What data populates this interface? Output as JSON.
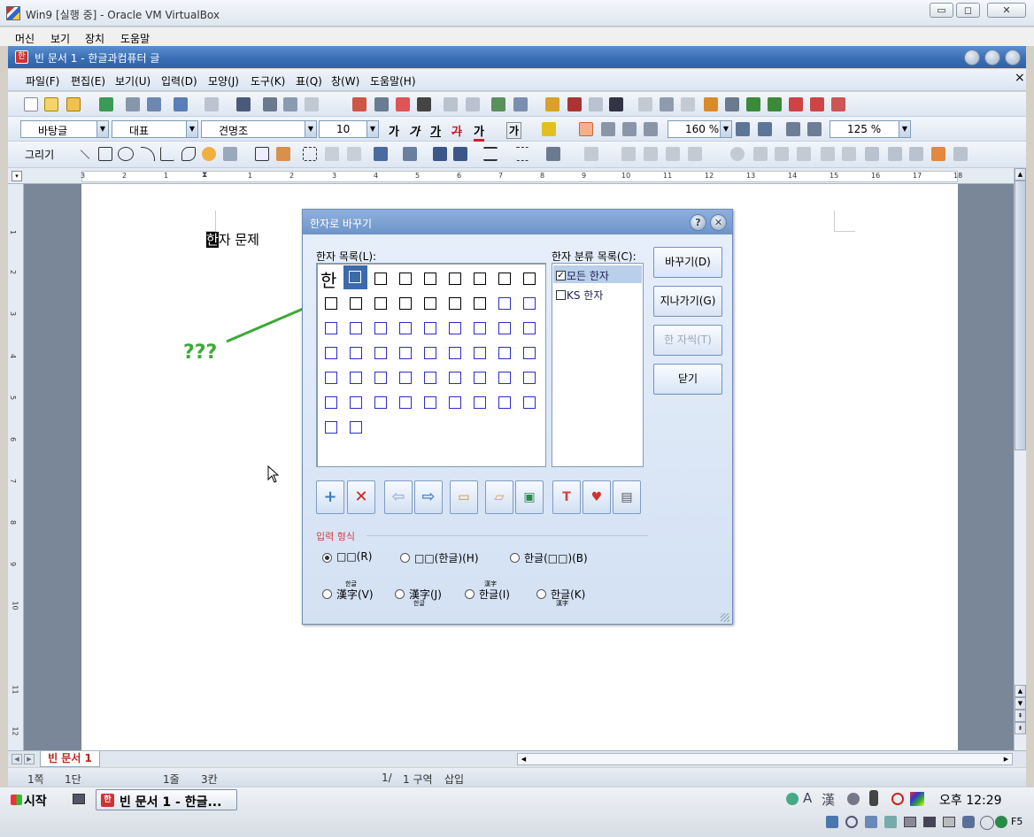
{
  "vbox": {
    "title": "Win9 [실행 중] - Oracle VM VirtualBox",
    "menu": [
      "머신",
      "보기",
      "장치",
      "도움말"
    ],
    "btn_min": "▭",
    "btn_max": "◻",
    "btn_close": "✕"
  },
  "hwp": {
    "title": "빈 문서 1 - 한글과컴퓨터    글",
    "app_icon": "한",
    "menu": [
      "파일(F)",
      "편집(E)",
      "보기(U)",
      "입력(D)",
      "모양(J)",
      "도구(K)",
      "표(Q)",
      "창(W)",
      "도움말(H)"
    ],
    "menu_close": "×",
    "format": {
      "style": "바탕글",
      "lang": "대표",
      "font": "견명조",
      "size": "10",
      "bold": "가",
      "italic": "가",
      "underline": "가",
      "strike": "가",
      "color_text": "가",
      "shade": "가",
      "line_spacing": "160 %",
      "zoom": "125 %"
    },
    "draw_label": "그리기",
    "ruler_numbers": [
      "3",
      "2",
      "1",
      "1",
      "2",
      "3",
      "4",
      "5",
      "6",
      "7",
      "8",
      "9",
      "10",
      "11",
      "12",
      "13",
      "14",
      "15",
      "16",
      "17",
      "18"
    ],
    "vruler_numbers": [
      "1",
      "2",
      "3",
      "4",
      "5",
      "6",
      "7",
      "8",
      "9",
      "10",
      "11",
      "12"
    ],
    "doc_text_highlight": "한",
    "doc_text_rest": "자 문제",
    "annotation": "???",
    "tab_name": "빈 문서 1",
    "status": {
      "page": "1쪽",
      "section_col": "1단",
      "line": "1줄",
      "column": "3칸",
      "page_of": "1/",
      "zone": "1 구역",
      "mode": "삽입"
    }
  },
  "dialog": {
    "title": "한자로 바꾸기",
    "help": "?",
    "close": "✕",
    "list_label": "한자 목록(L):",
    "category_label": "한자 분류 목록(C):",
    "source_char": "한",
    "categories": [
      {
        "label": "모든 한자",
        "checked": true
      },
      {
        "label": "KS 한자",
        "checked": false
      }
    ],
    "buttons": {
      "replace": "바꾸기(D)",
      "skip": "지나가기(G)",
      "one_char": "한 자씩(T)",
      "close": "닫기"
    },
    "icon_buttons": [
      "add-icon",
      "delete-icon",
      "prev-icon",
      "next-icon",
      "open-dict-icon",
      "folder-icon",
      "save-icon",
      "tools-icon",
      "book-icon",
      "settings-icon"
    ],
    "input_format_label": "입력 형식",
    "options": [
      {
        "label": "□□(R)",
        "checked": true
      },
      {
        "label": "□□(한글)(H)",
        "checked": false
      },
      {
        "label": "한글(□□)(B)",
        "checked": false
      },
      {
        "label": "漢字(V)",
        "sup": "한글",
        "checked": false
      },
      {
        "label": "漢字(J)",
        "sub": "한글",
        "checked": false
      },
      {
        "label": "한글(I)",
        "sup": "漢字",
        "checked": false
      },
      {
        "label": "한글(K)",
        "sub": "漢字",
        "checked": false
      }
    ]
  },
  "taskbar": {
    "start": "시작",
    "task": "빈 문서 1 - 한글...",
    "task_icon": "한",
    "ime_a": "A",
    "ime_han": "漢",
    "time": "오후 12:29",
    "host_key": "F5"
  },
  "colors": {
    "hwp_title": "#3a6fb6",
    "dialog_bg": "#d9e6f6",
    "selected_cell": "#3d6aa8",
    "annotation_green": "#3aaa35",
    "cell_blue": "#2c2cc8"
  }
}
